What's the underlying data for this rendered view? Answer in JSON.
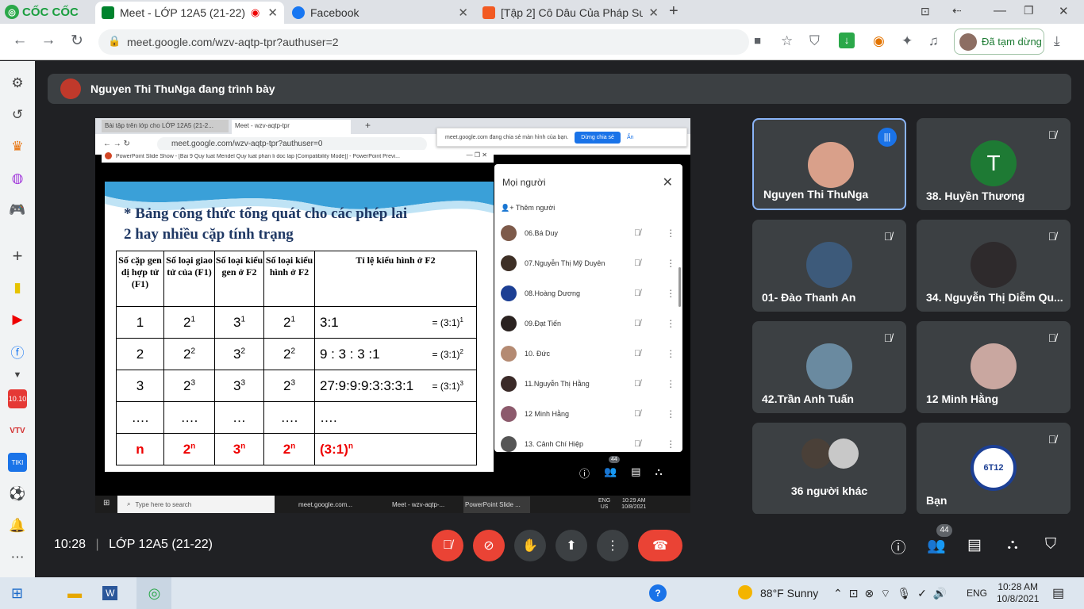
{
  "browser": {
    "brand": "CỐC CỐC",
    "tabs": [
      {
        "label": "Meet - LỚP 12A5 (21-22)",
        "active": true
      },
      {
        "label": "Facebook",
        "active": false
      },
      {
        "label": "[Tập 2] Cô Dâu Của Pháp Sư",
        "active": false
      }
    ],
    "url": "meet.google.com/wzv-aqtp-tpr?authuser=2",
    "paused_label": "Đã tạm dừng",
    "colors": {
      "accent": "#1a73e8",
      "end_call": "#ea4335"
    }
  },
  "presenter_banner": "Nguyen Thi ThuNga đang trình bày",
  "shared": {
    "tabs": [
      "Bài tập trên lớp cho LỚP 12A5 (21-2...",
      "Meet - wzv-aqtp-tpr"
    ],
    "url": "meet.google.com/wzv-aqtp-tpr?authuser=0",
    "share_notice": "meet.google.com đang chia sẻ màn hình của bạn.",
    "stop_share": "Dừng chia sẻ",
    "hide": "Ẩn",
    "ppt_title": "PowerPoint Slide Show - [Bai 9 Quy luat Mendel Quy luat phan li doc lap [Compatibility Mode]] - PowerPoint Previ...",
    "slide": {
      "heading_line1": "* Bảng công thức tổng quát cho các phép lai",
      "heading_line2": "2 hay nhiều cặp tính trạng",
      "headers": [
        "Số cặp gen dị hợp tử (F1)",
        "Số loại giao tử của (F1)",
        "Số loại kiểu gen ở F2",
        "Số loại kiểu hình ở F2",
        "Tỉ lệ kiểu hình ở F2"
      ],
      "rows": [
        {
          "pairs": "1",
          "gametes_base": "2",
          "gametes_exp": "1",
          "genotypes_base": "3",
          "genotypes_exp": "1",
          "phenotypes_base": "2",
          "phenotypes_exp": "1",
          "ratio": "3:1",
          "formula_base": "= (3:1)",
          "formula_exp": "1"
        },
        {
          "pairs": "2",
          "gametes_base": "2",
          "gametes_exp": "2",
          "genotypes_base": "3",
          "genotypes_exp": "2",
          "phenotypes_base": "2",
          "phenotypes_exp": "2",
          "ratio": "9 : 3 : 3 :1",
          "formula_base": "= (3:1)",
          "formula_exp": "2"
        },
        {
          "pairs": "3",
          "gametes_base": "2",
          "gametes_exp": "3",
          "genotypes_base": "3",
          "genotypes_exp": "3",
          "phenotypes_base": "2",
          "phenotypes_exp": "3",
          "ratio": "27:9:9:9:3:3:3:1",
          "formula_base": "= (3:1)",
          "formula_exp": "3"
        },
        {
          "pairs": "….",
          "gametes_base": "….",
          "gametes_exp": "",
          "genotypes_base": "…",
          "genotypes_exp": "",
          "phenotypes_base": "….",
          "phenotypes_exp": "",
          "ratio": "….",
          "formula_base": "",
          "formula_exp": ""
        },
        {
          "pairs": "n",
          "gametes_base": "2",
          "gametes_exp": "n",
          "genotypes_base": "3",
          "genotypes_exp": "n",
          "phenotypes_base": "2",
          "phenotypes_exp": "n",
          "ratio": "(3:1)",
          "formula_base": "",
          "formula_exp": "n"
        }
      ]
    },
    "people_panel": {
      "title": "Mọi người",
      "add": "Thêm người",
      "count": "44",
      "people": [
        "06.Bá Duy",
        "07.Nguyễn Thị Mỹ Duyên",
        "08.Hoàng Dương",
        "09.Đạt Tiến",
        "10. Đức",
        "11.Nguyễn Thị Hằng",
        "12 Minh Hằng",
        "13. Cảnh Chí Hiệp"
      ]
    },
    "taskbar": {
      "search": "Type here to search",
      "apps": [
        "meet.google.com...",
        "Meet - wzv-aqtp-...",
        "PowerPoint Slide ..."
      ],
      "lang": "ENG",
      "region": "US",
      "time": "10:29 AM",
      "date": "10/8/2021"
    }
  },
  "tiles": [
    {
      "name": "Nguyen Thi ThuNga",
      "speaking": true
    },
    {
      "name": "38. Huyền Thương",
      "initial": "T"
    },
    {
      "name": "01- Đào Thanh An"
    },
    {
      "name": "34. Nguyễn Thị Diễm Qu..."
    },
    {
      "name": "42.Trần Anh Tuấn"
    },
    {
      "name": "12 Minh Hằng"
    },
    {
      "name": "36 người khác"
    },
    {
      "name": "Bạn",
      "logo_text": "6T12"
    }
  ],
  "bottom": {
    "time": "10:28",
    "meeting": "LỚP 12A5 (21-22)",
    "participants": "44"
  },
  "windows": {
    "weather": "88°F  Sunny",
    "lang": "ENG",
    "time": "10:28 AM",
    "date": "10/8/2021"
  }
}
